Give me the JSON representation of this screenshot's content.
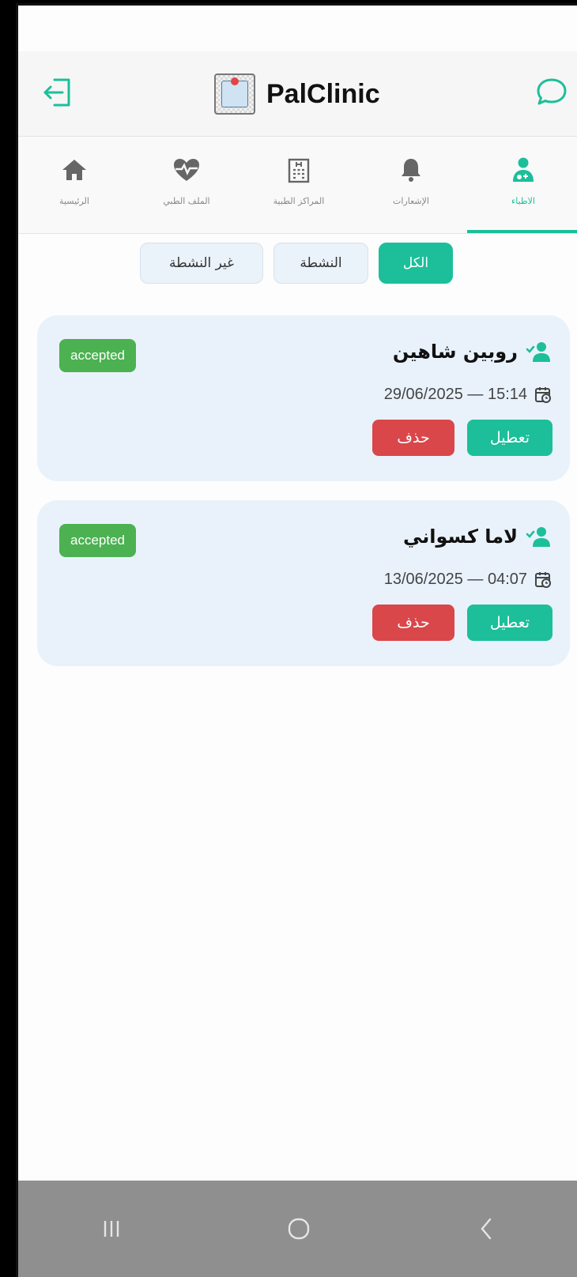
{
  "app": {
    "name": "PalClinic"
  },
  "header": {
    "logout_icon": "logout-icon",
    "chat_icon": "chat-bubble-icon"
  },
  "tabs": [
    {
      "label": "الاطباء",
      "icon": "doctor-icon",
      "active": true
    },
    {
      "label": "الإشعارات",
      "icon": "bell-icon",
      "active": false
    },
    {
      "label": "المراكز الطبية",
      "icon": "hospital-icon",
      "active": false
    },
    {
      "label": "الملف الطبي",
      "icon": "heartbeat-icon",
      "active": false
    },
    {
      "label": "الرئيسية",
      "icon": "home-icon",
      "active": false
    }
  ],
  "filters": [
    {
      "label": "الكل",
      "active": true
    },
    {
      "label": "النشطة",
      "active": false
    },
    {
      "label": "غير النشطة",
      "active": false
    }
  ],
  "doctors": [
    {
      "name": "روبين شاهين",
      "status": "accepted",
      "datetime": "29/06/2025 — 15:14",
      "disable_label": "تعطيل",
      "delete_label": "حذف"
    },
    {
      "name": "لاما كسواني",
      "status": "accepted",
      "datetime": "13/06/2025 — 04:07",
      "disable_label": "تعطيل",
      "delete_label": "حذف"
    }
  ],
  "colors": {
    "accent": "#1cbf9a",
    "danger": "#d9474a",
    "badge": "#4cb151",
    "card_bg": "#e9f2fb"
  },
  "system_nav": {
    "recent_icon": "recent-apps-icon",
    "home_icon": "home-circle-icon",
    "back_icon": "back-chevron-icon"
  }
}
